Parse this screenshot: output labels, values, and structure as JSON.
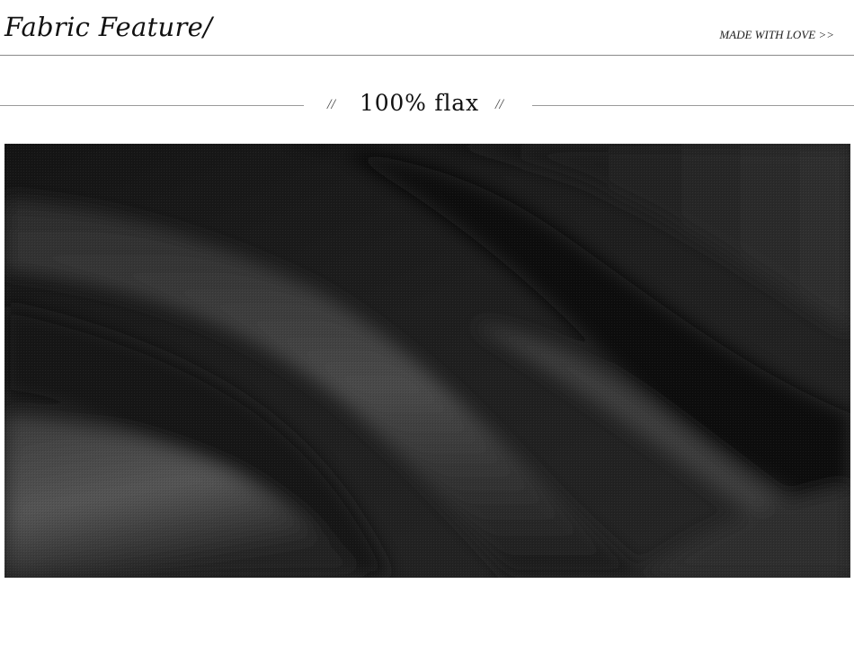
{
  "header": {
    "title": "Fabric Feature/",
    "tagline": "MADE WITH LOVE >>"
  },
  "section": {
    "slash_left": "//",
    "heading": "100% flax",
    "slash_right": "//"
  },
  "photo": {
    "subject": "black-linen-fabric-folds",
    "base_color": "#1c1c1c",
    "highlight_color": "#4a4a4a"
  }
}
